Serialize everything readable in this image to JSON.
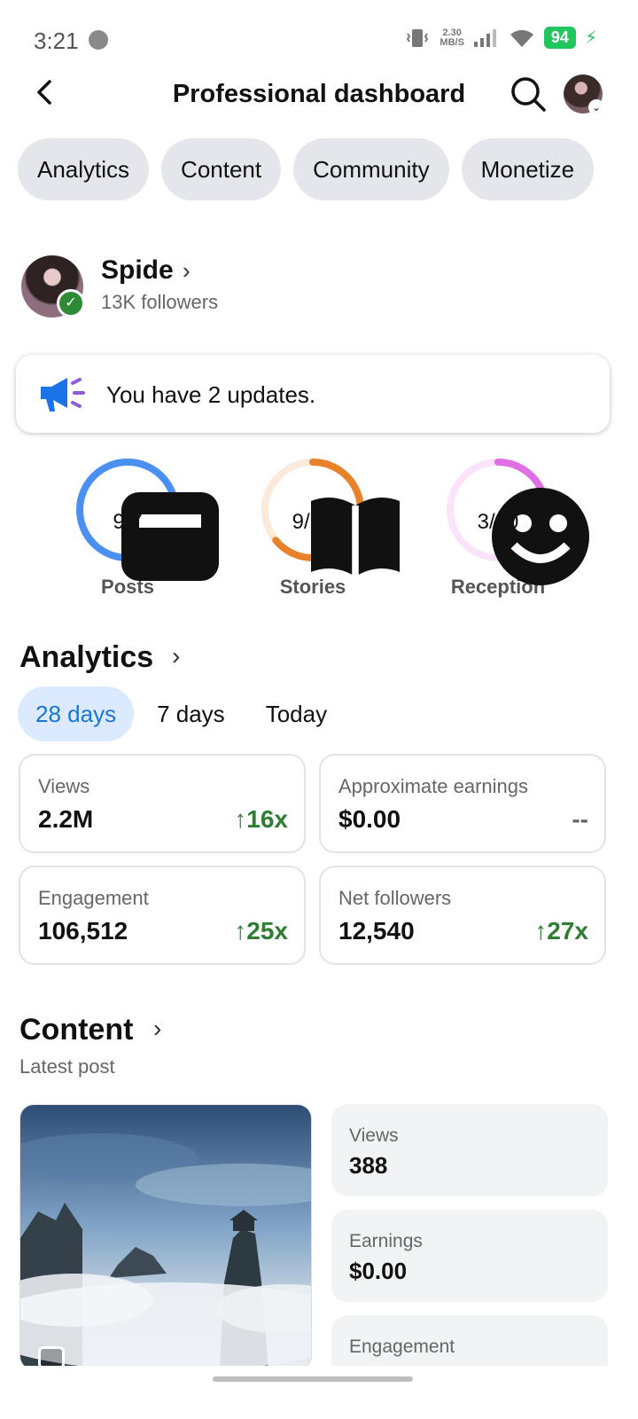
{
  "status_bar": {
    "time": "3:21",
    "net_speed_value": "2.30",
    "net_speed_unit": "MB/S",
    "battery": "94",
    "icons": [
      "messenger-icon",
      "vibrate-icon",
      "signal-icon",
      "wifi-icon",
      "battery-icon",
      "charging-icon"
    ]
  },
  "header": {
    "title": "Professional dashboard"
  },
  "tabs": [
    "Analytics",
    "Content",
    "Community",
    "Monetize"
  ],
  "profile": {
    "name": "Spide",
    "followers": "13K followers"
  },
  "updates": {
    "text": "You have 2 updates."
  },
  "rings": [
    {
      "label": "Posts",
      "value": "9/7",
      "progress": 1.0,
      "color": "#4a90f0",
      "track": "#dbe8fb",
      "icon": "post-icon"
    },
    {
      "label": "Stories",
      "value": "9/14",
      "progress": 0.64,
      "color": "#e8822a",
      "track": "#fbe9da",
      "icon": "book-icon"
    },
    {
      "label": "Reception",
      "value": "3/10",
      "progress": 0.3,
      "color": "#e26ee6",
      "track": "#fbe3fb",
      "icon": "smiley-icon"
    }
  ],
  "analytics": {
    "title": "Analytics",
    "periods": [
      "28 days",
      "7 days",
      "Today"
    ],
    "active_period": "28 days",
    "stats": [
      {
        "label": "Views",
        "value": "2.2M",
        "change": "16x"
      },
      {
        "label": "Approximate earnings",
        "value": "$0.00",
        "change": "--"
      },
      {
        "label": "Engagement",
        "value": "106,512",
        "change": "25x"
      },
      {
        "label": "Net followers",
        "value": "12,540",
        "change": "27x"
      }
    ]
  },
  "content": {
    "title": "Content",
    "subtitle": "Latest post",
    "post_stats": [
      {
        "label": "Views",
        "value": "388"
      },
      {
        "label": "Earnings",
        "value": "$0.00"
      },
      {
        "label": "Engagement",
        "value": ""
      }
    ]
  },
  "colors": {
    "accent": "#1976d2",
    "positive": "#2e7d32",
    "chip_bg": "#e4e6eb"
  }
}
